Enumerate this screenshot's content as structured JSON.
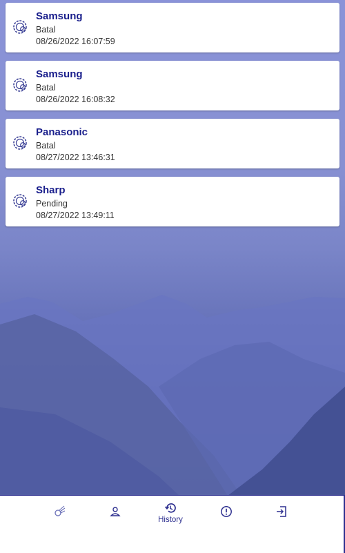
{
  "history": [
    {
      "brand": "Samsung",
      "status": "Batal",
      "datetime": "08/26/2022 16:07:59",
      "icon": "gear-icon"
    },
    {
      "brand": "Samsung",
      "status": "Batal",
      "datetime": "08/26/2022 16:08:32",
      "icon": "gear-icon"
    },
    {
      "brand": "Panasonic",
      "status": "Batal",
      "datetime": "08/27/2022 13:46:31",
      "icon": "gear-icon"
    },
    {
      "brand": "Sharp",
      "status": "Pending",
      "datetime": "08/27/2022 13:49:11",
      "icon": "gear-icon"
    }
  ],
  "nav": {
    "items": [
      {
        "id": "service",
        "icon": "comet-icon",
        "label": ""
      },
      {
        "id": "profile",
        "icon": "person-icon",
        "label": ""
      },
      {
        "id": "history",
        "icon": "history-icon",
        "label": "History",
        "active": true
      },
      {
        "id": "info",
        "icon": "info-icon",
        "label": ""
      },
      {
        "id": "logout",
        "icon": "logout-icon",
        "label": ""
      }
    ]
  },
  "colors": {
    "accent": "#1a1f8c",
    "nav": "#2d2f8f",
    "background": "#7a85c8"
  }
}
